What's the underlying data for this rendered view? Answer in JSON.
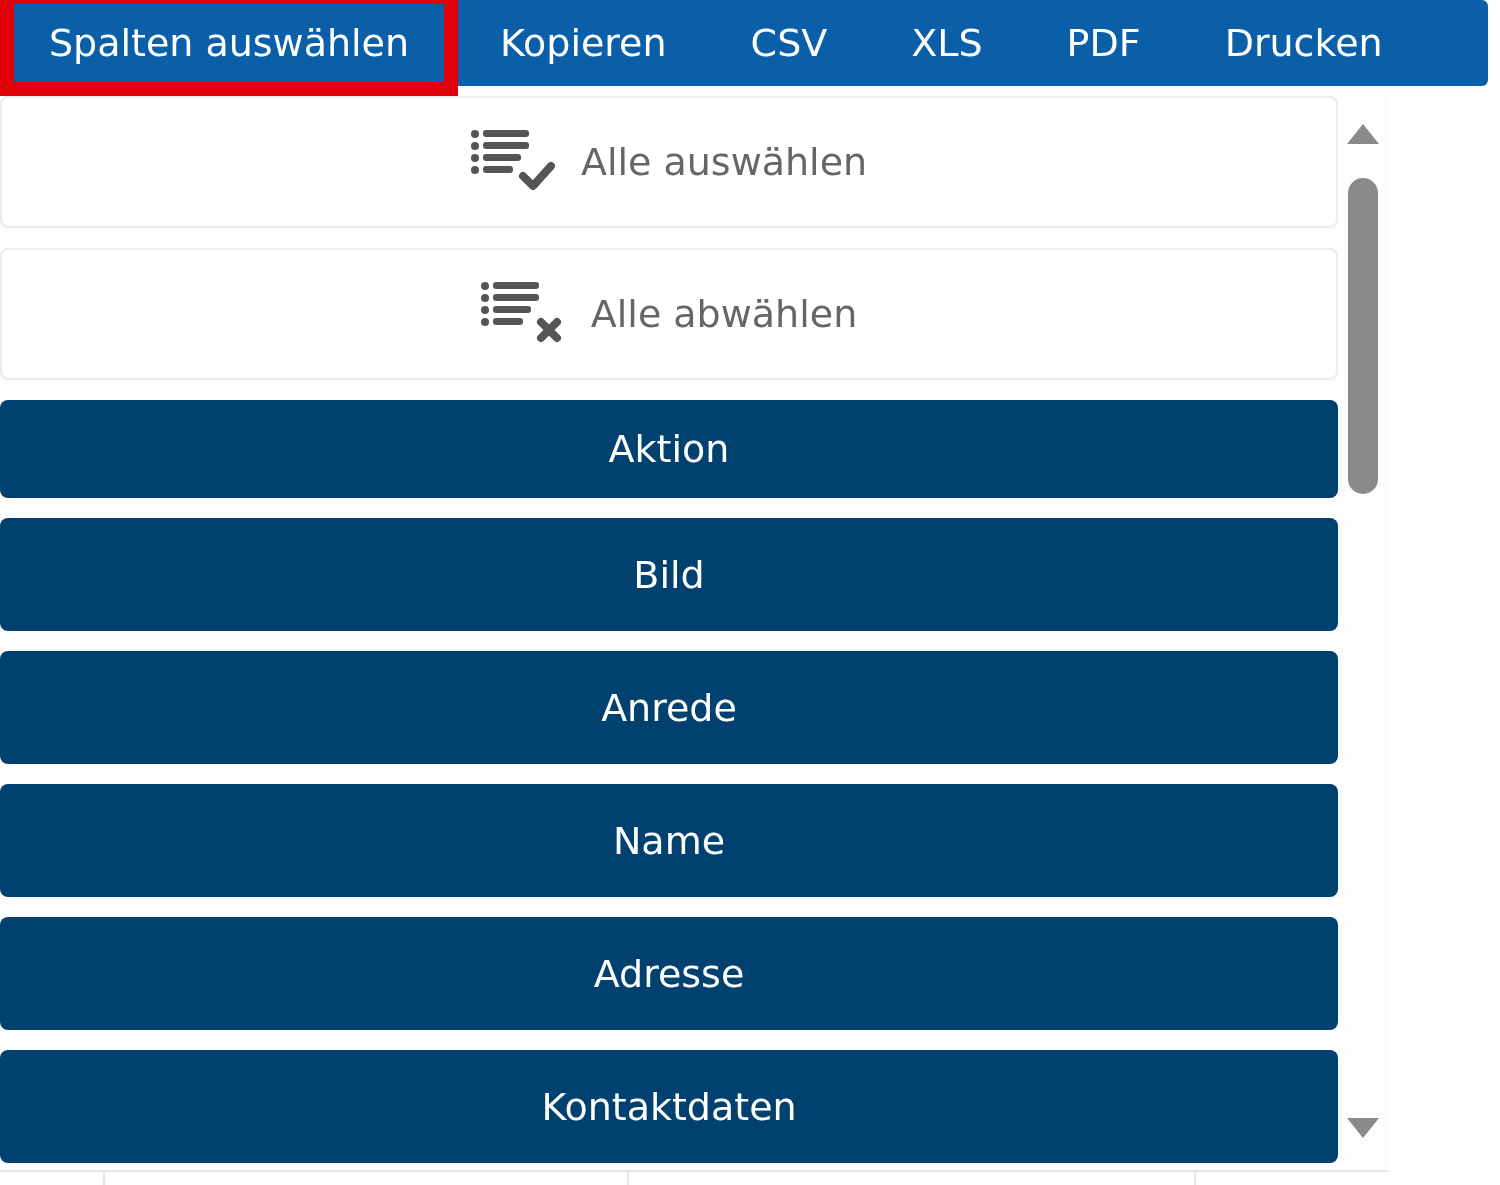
{
  "toolbar": {
    "buttons": [
      {
        "label": "Spalten auswählen",
        "highlighted": true
      },
      {
        "label": "Kopieren",
        "highlighted": false
      },
      {
        "label": "CSV",
        "highlighted": false
      },
      {
        "label": "XLS",
        "highlighted": false
      },
      {
        "label": "PDF",
        "highlighted": false
      },
      {
        "label": "Drucken",
        "highlighted": false
      }
    ]
  },
  "column_menu": {
    "items": [
      {
        "kind": "select_all",
        "label": "Alle auswählen"
      },
      {
        "kind": "deselect_all",
        "label": "Alle abwählen"
      },
      {
        "kind": "column",
        "label": "Aktion",
        "selected": true
      },
      {
        "kind": "column",
        "label": "Bild",
        "selected": true
      },
      {
        "kind": "column",
        "label": "Anrede",
        "selected": true
      },
      {
        "kind": "column",
        "label": "Name",
        "selected": true
      },
      {
        "kind": "column",
        "label": "Adresse",
        "selected": true
      },
      {
        "kind": "column",
        "label": "Kontaktdaten",
        "selected": true
      }
    ]
  }
}
